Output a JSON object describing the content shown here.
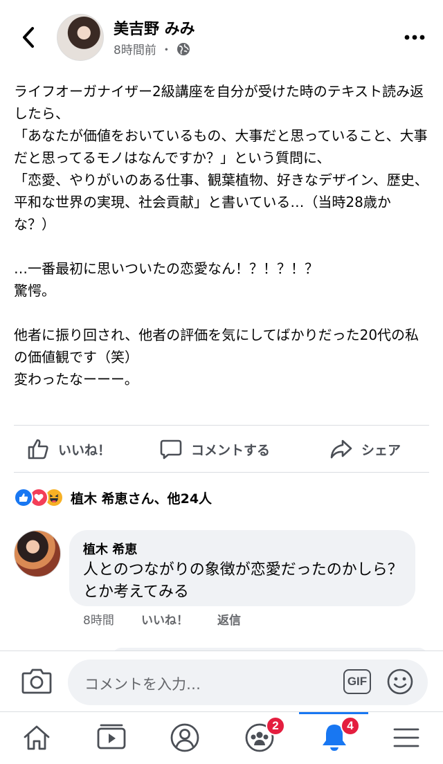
{
  "post": {
    "author": "美吉野 みみ",
    "time": "8時間前",
    "separator": "・",
    "text": "ライフオーガナイザー2級講座を自分が受けた時のテキスト読み返したら、\n「あなたが価値をおいているもの、大事だと思っていること、大事だと思ってるモノはなんですか？」という質問に、\n「恋愛、やりがいのある仕事、観葉植物、好きなデザイン、歴史、平和な世界の実現、社会貢献」と書いている…（当時28歳かな？）\n\n…一番最初に思いついたの恋愛なん！？！？！？\n驚愕。\n\n他者に振り回され、他者の評価を気にしてばかりだった20代の私の価値観です（笑）\n変わったなーーー。"
  },
  "actions": {
    "like": "いいね！",
    "comment": "コメントする",
    "share": "シェア"
  },
  "reactions": {
    "summary": "植木 希恵さん、他24人",
    "types": [
      "like",
      "love",
      "haha"
    ]
  },
  "comment": {
    "author": "植木 希恵",
    "text": "人とのつながりの象徴が恋愛だったのかしら？とか考えてみる",
    "time": "8時間",
    "like_label": "いいね！",
    "reply_label": "返信"
  },
  "composer": {
    "placeholder": "コメントを入力…",
    "gif_label": "GIF"
  },
  "bottom_nav": {
    "groups_badge": "2",
    "notifications_badge": "4",
    "active": "notifications"
  },
  "colors": {
    "brand_blue": "#1877f2",
    "badge_red": "#e41e3f",
    "love_red": "#f33e58",
    "haha_yellow": "#f7b125"
  }
}
